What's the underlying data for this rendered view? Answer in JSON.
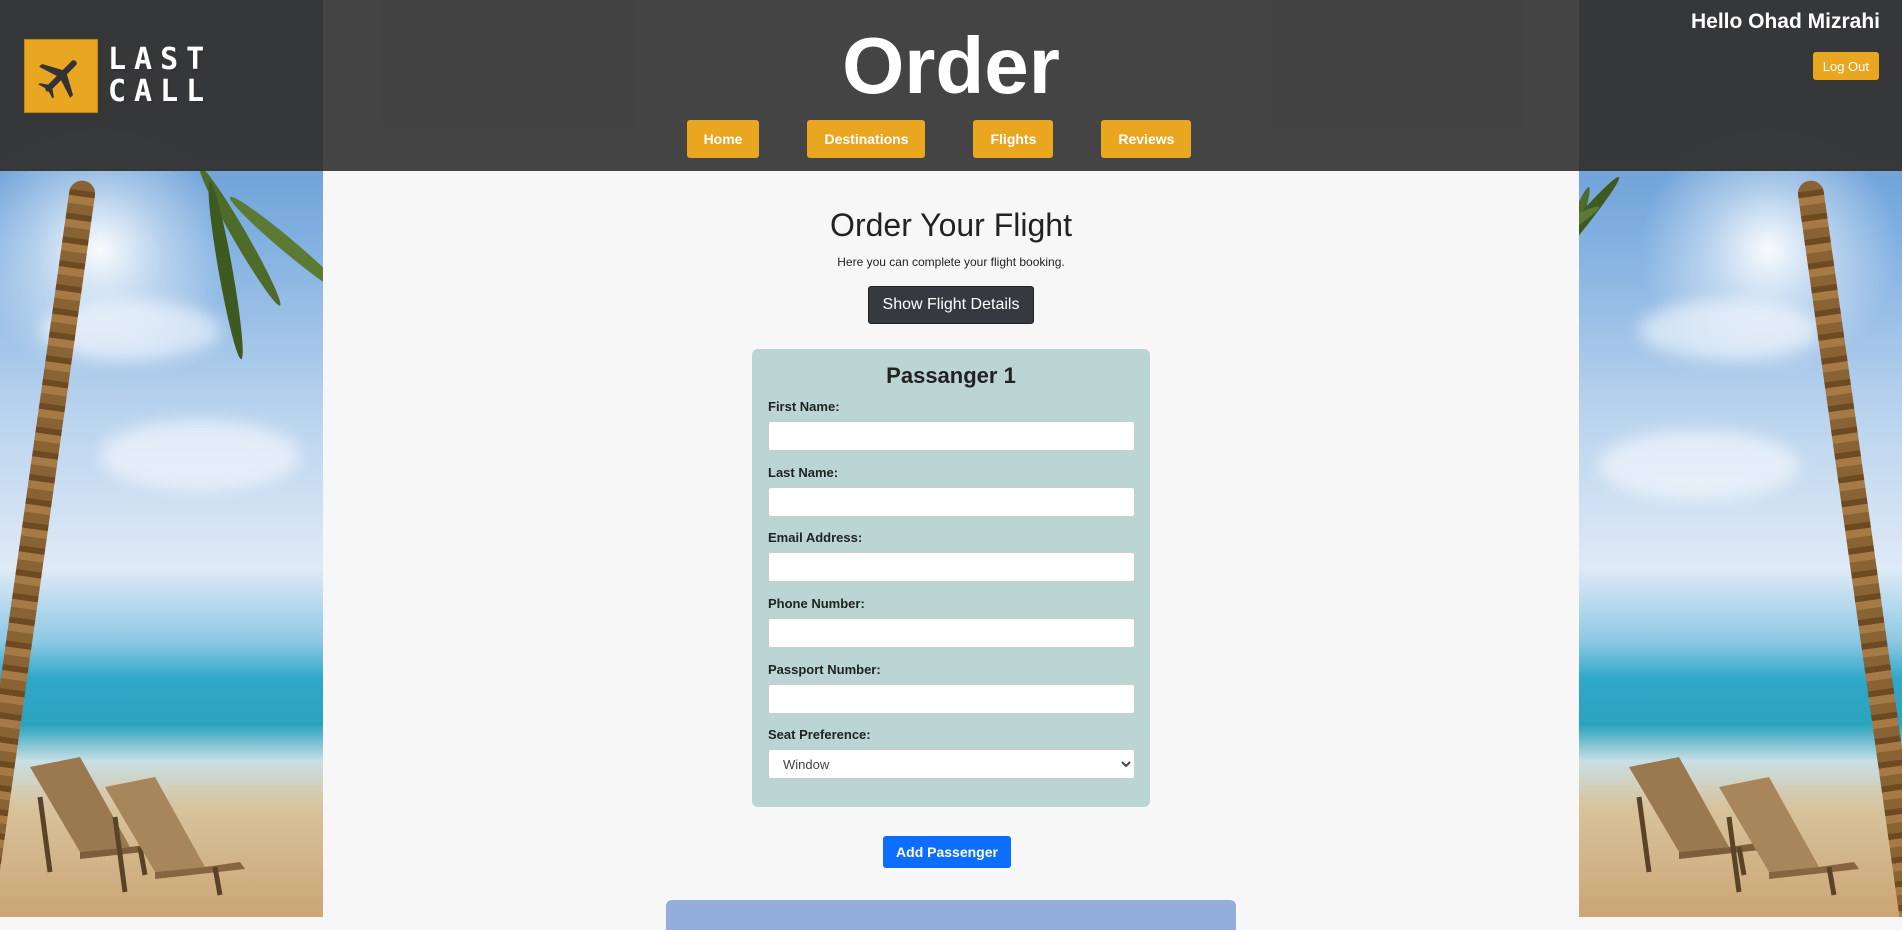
{
  "header": {
    "title": "Order",
    "logo_text_line1": "LAST",
    "logo_text_line2": "CALL",
    "greeting": "Hello Ohad Mizrahi",
    "logout_label": "Log Out",
    "nav": [
      {
        "label": "Home"
      },
      {
        "label": "Destinations"
      },
      {
        "label": "Flights"
      },
      {
        "label": "Reviews"
      }
    ]
  },
  "main": {
    "heading": "Order Your Flight",
    "subheading": "Here you can complete your flight booking.",
    "details_button": "Show Flight Details",
    "passenger": {
      "title": "Passanger 1",
      "fields": [
        {
          "label": "First Name:",
          "value": ""
        },
        {
          "label": "Last Name:",
          "value": ""
        },
        {
          "label": "Email Address:",
          "value": ""
        },
        {
          "label": "Phone Number:",
          "value": ""
        },
        {
          "label": "Passport Number:",
          "value": ""
        }
      ],
      "seat_label": "Seat Preference:",
      "seat_value": "Window"
    },
    "add_button": "Add Passenger"
  },
  "colors": {
    "accent": "#e9a621",
    "header_bg": "#3c3c3c",
    "card_bg": "#bad5d4",
    "primary_button": "#0d6efd",
    "dark_button": "#343a40"
  }
}
